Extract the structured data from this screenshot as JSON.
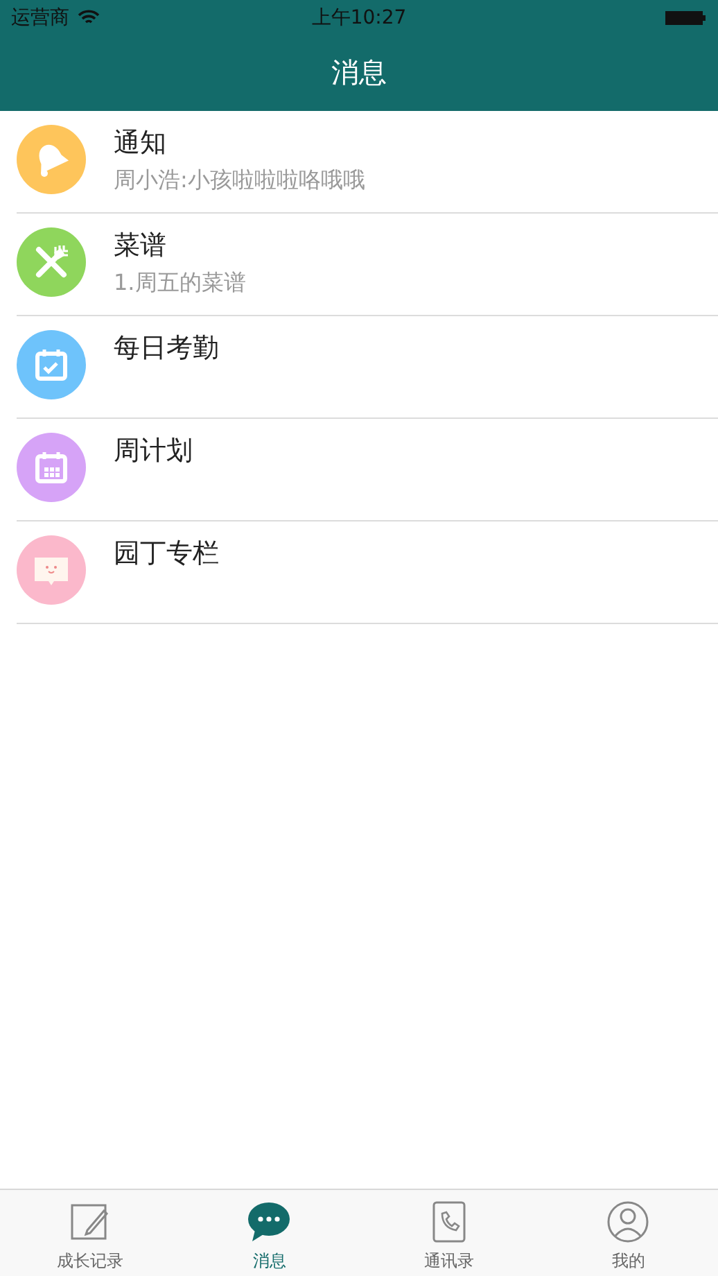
{
  "status_bar": {
    "carrier": "运营商",
    "time": "上午10:27"
  },
  "header": {
    "title": "消息"
  },
  "messages": [
    {
      "kind": "bell",
      "color": "#fec55b",
      "title": "通知",
      "preview": "周小浩:小孩啦啦啦咯哦哦"
    },
    {
      "kind": "cutlery",
      "color": "#8fd65c",
      "title": "菜谱",
      "preview": "1.周五的菜谱"
    },
    {
      "kind": "check-calendar",
      "color": "#6ec3fb",
      "title": "每日考勤"
    },
    {
      "kind": "grid-calendar",
      "color": "#d6a3f7",
      "title": "周计划"
    },
    {
      "kind": "chat",
      "color": "#fbb8cb",
      "title": "园丁专栏"
    }
  ],
  "tabs": [
    {
      "kind": "note",
      "label": "成长记录",
      "selected": false
    },
    {
      "kind": "message",
      "label": "消息",
      "selected": true
    },
    {
      "kind": "contacts",
      "label": "通讯录",
      "selected": false
    },
    {
      "kind": "person",
      "label": "我的",
      "selected": false
    }
  ]
}
